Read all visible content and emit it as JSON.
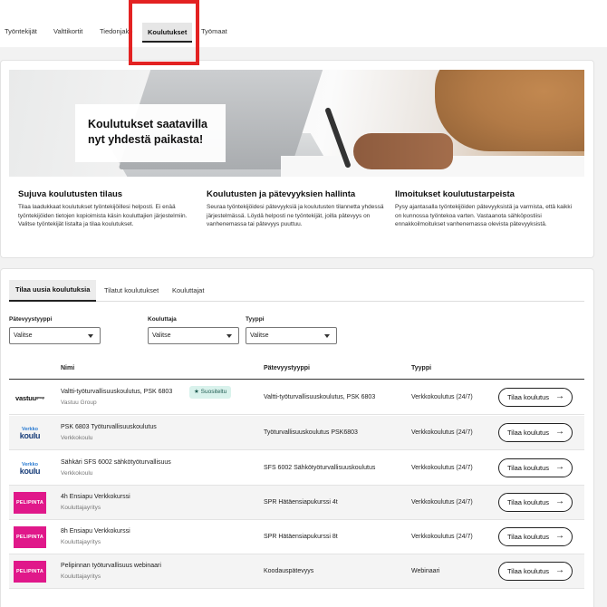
{
  "top_tabs": [
    {
      "label": "Työntekijät"
    },
    {
      "label": "Valttikortit"
    },
    {
      "label": "Tiedonjako"
    },
    {
      "label": "Koulutukset"
    },
    {
      "label": "Työmaat"
    }
  ],
  "hero": {
    "title_line1": "Koulutukset saatavilla",
    "title_line2": "nyt yhdestä paikasta!"
  },
  "features": [
    {
      "title": "Sujuva koulutusten tilaus",
      "text": "Tilaa laadukkaat koulutukset työntekijöillesi helposti. Ei enää työntekijöiden tietojen kopioimista käsin kouluttajien järjestelmiin. Valitse työntekijät listalta ja tilaa koulutukset."
    },
    {
      "title": "Koulutusten ja pätevyyksien hallinta",
      "text": "Seuraa työntekijöidesi pätevyyksiä ja koulutusten tilannetta yhdessä järjestelmässä. Löydä helposti ne työntekijät, joilla pätevyys on vanhenemassa tai pätevyys puuttuu."
    },
    {
      "title": "Ilmoitukset koulutustarpeista",
      "text": "Pysy ajantasalla työntekijöiden pätevyyksistä ja varmista, että kaikki on kunnossa työntekoa varten. Vastaanota sähköpostiisi ennakkoilmoitukset vanhenemassa olevista pätevyyksistä."
    }
  ],
  "sub_tabs": [
    {
      "label": "Tilaa uusia koulutuksia"
    },
    {
      "label": "Tilatut koulutukset"
    },
    {
      "label": "Kouluttajat"
    }
  ],
  "filters": [
    {
      "label": "Pätevyystyyppi",
      "value": "Valitse"
    },
    {
      "label": "Kouluttaja",
      "value": "Valitse"
    },
    {
      "label": "Tyyppi",
      "value": "Valitse"
    }
  ],
  "table": {
    "headers": {
      "name": "Nimi",
      "competence": "Pätevyystyyppi",
      "type": "Tyyppi"
    },
    "button_label": "Tilaa koulutus",
    "rows": [
      {
        "logo": "vastuu",
        "logo_text": "vastuu",
        "logo_sup": "group",
        "name": "Valtti-työturvallisuuskoulutus, PSK 6803",
        "provider": "Vastuu Group",
        "badge": "★ Suositeltu",
        "competence": "Valtti-työturvallisuuskoulutus, PSK 6803",
        "type": "Verkkokoulutus (24/7)"
      },
      {
        "logo": "verkkokoulu",
        "logo_text1": "Verkko",
        "logo_text2": "koulu",
        "name": "PSK 6803 Työturvallisuuskoulutus",
        "provider": "Verkkokoulu",
        "competence": "Työturvallisuuskoulutus PSK6803",
        "type": "Verkkokoulutus (24/7)"
      },
      {
        "logo": "verkkokoulu",
        "logo_text1": "Verkko",
        "logo_text2": "koulu",
        "name": "Sähkäri SFS 6002 sähkötyöturvallisuus",
        "provider": "Verkkokoulu",
        "competence": "SFS 6002 Sähkötyöturvallisuuskoulutus",
        "type": "Verkkokoulutus (24/7)"
      },
      {
        "logo": "pelipinta",
        "logo_text": "PELIPINTA",
        "name": "4h Ensiapu Verkkokurssi",
        "provider": "Kouluttajayritys",
        "competence": "SPR Hätäensiapukurssi 4t",
        "type": "Verkkokoulutus (24/7)"
      },
      {
        "logo": "pelipinta",
        "logo_text": "PELIPINTA",
        "name": "8h Ensiapu Verkkokurssi",
        "provider": "Kouluttajayritys",
        "competence": "SPR Hätäensiapukurssi 8t",
        "type": "Verkkokoulutus (24/7)"
      },
      {
        "logo": "pelipinta",
        "logo_text": "PELIPINTA",
        "name": "Pelipinnan työturvallisuus webinaari",
        "provider": "Kouluttajayritys",
        "competence": "Koodauspätevyys",
        "type": "Webinaari"
      }
    ]
  },
  "icons": {
    "select_chevron": "chevron-down-icon",
    "button_arrow": "arrow-right-icon"
  },
  "colors": {
    "highlight": "#e32222",
    "badge_bg": "#d9f2ec",
    "pelipinta": "#e0188a"
  }
}
